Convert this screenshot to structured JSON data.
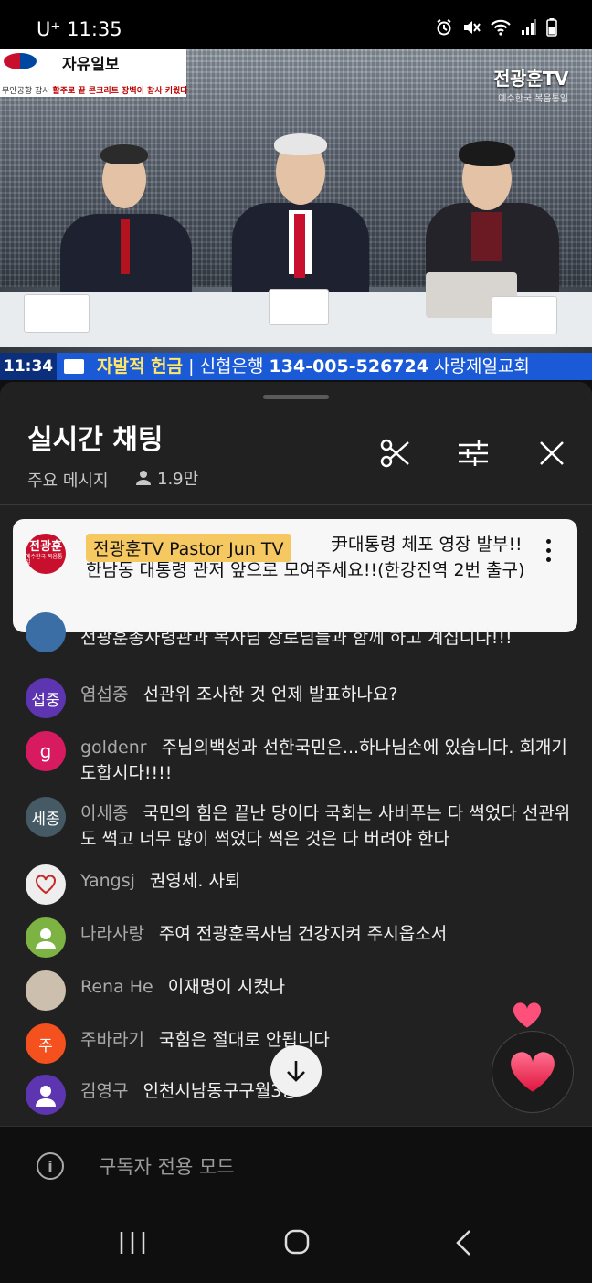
{
  "status_bar": {
    "carrier_time": "U⁺ 11:35"
  },
  "video": {
    "newspaper_title": "자유일보",
    "newspaper_headline_prefix": "무안공항 참사",
    "newspaper_headline": "활주로 끝 콘크리트 장벽이 참사 키웠다",
    "channel_brand": "전광훈TV",
    "channel_sub": "예수한국 복음통일",
    "ticker_time": "11:34",
    "ticker_label": "자발적 헌금",
    "ticker_bank": "신협은행",
    "ticker_account": "134-005-526724",
    "ticker_church": "사랑제일교회"
  },
  "chat": {
    "title": "실시간 채팅",
    "mode": "주요 메시지",
    "viewers": "1.9만",
    "pinned": {
      "avatar_text": "전광훈",
      "avatar_sub": "예수한국 복음통일",
      "author": "전광훈TV Pastor Jun TV",
      "text": "尹대통령 체포 영장 발부!! 한남동 대통령 관저 앞으로 모여주세요!!(한강진역 2번 출구)"
    },
    "messages": [
      {
        "author": "",
        "avatar_text": "",
        "text": "전광훈총사령관과 목사님 장로님들과 함께 하고 계십니다!!!",
        "color": "#3a6ea5"
      },
      {
        "author": "염섭중",
        "avatar_text": "섭중",
        "text": "선관위 조사한 것 언제 발표하나요?",
        "color": "#5e35b1"
      },
      {
        "author": "goldenr",
        "avatar_text": "g",
        "text": "주님의백성과 선한국민은...하나님손에 있습니다. 회개기도합시다!!!!",
        "color": "#d81b60"
      },
      {
        "author": "이세종",
        "avatar_text": "세종",
        "text": "국민의 힘은 끝난 당이다 국회는 사버푸는 다 썩었다 선관위도 썩고 너무 많이 썩었다 썩은 것은 다 버려야 한다",
        "color": "#455a64"
      },
      {
        "author": "Yangsj",
        "avatar_text": "",
        "text": "권영세. 사퇴",
        "color": "#eeeeee"
      },
      {
        "author": "나라사랑",
        "avatar_text": "",
        "text": "주여 전광훈목사님 건강지켜 주시옵소서",
        "color": "#7cb342"
      },
      {
        "author": "Rena He",
        "avatar_text": "",
        "text": "이재명이 시켰나",
        "color": "#cdbfae"
      },
      {
        "author": "주바라기",
        "avatar_text": "주",
        "text": "국힘은 절대로 안됩니다",
        "color": "#f4511e"
      },
      {
        "author": "김영구",
        "avatar_text": "",
        "text": "인천시남동구구월3동",
        "color": "#5e35b1"
      }
    ],
    "input_placeholder": "구독자 전용 모드"
  },
  "icons": [
    "alarm-icon",
    "mute-icon",
    "wifi-icon",
    "signal-icon",
    "battery-icon",
    "scissors-icon",
    "filter-icon",
    "close-icon",
    "more-icon",
    "person-icon",
    "heart-icon",
    "arrow-down-icon",
    "info-icon",
    "recents-icon",
    "home-icon",
    "back-icon"
  ]
}
